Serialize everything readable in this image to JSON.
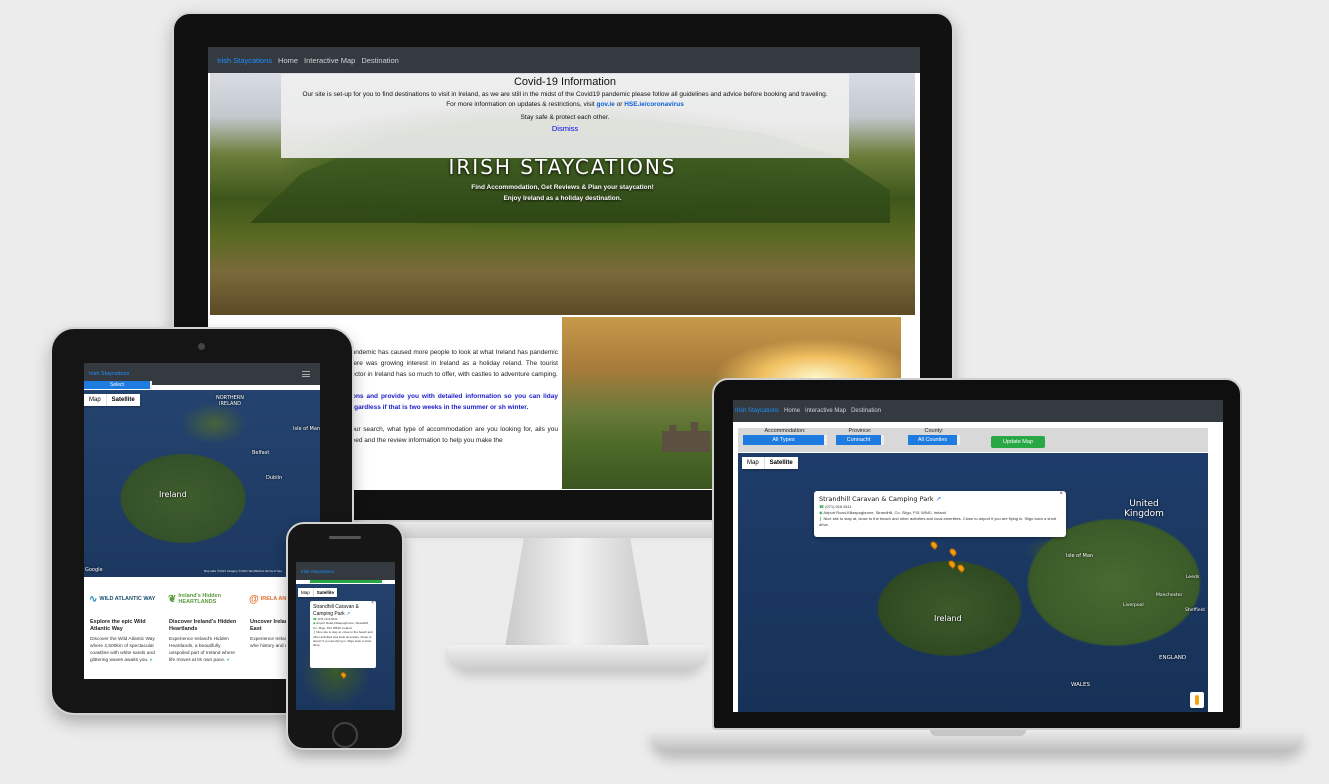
{
  "nav": {
    "brand": "Irish Staycations",
    "home": "Home",
    "map": "Interactive Map",
    "destination": "Destination"
  },
  "covid": {
    "title": "Covid-19 Information",
    "line1": "Our site is set-up for you to find destinations to visit in Ireland, as we are still in the midst of the Covid19 pandemic please follow all guidelines and advice before booking and traveling.",
    "line2_prefix": "For more information on updates & restrictions, visit",
    "link1": "gov.ie",
    "or": "or",
    "link2": "HSE.ie/coronavirus",
    "line3": "Stay safe & protect each other.",
    "dismiss": "Dismiss"
  },
  "hero": {
    "title": "IRISH STAYCATIONS",
    "sub1": "Find Accommodation, Get Reviews & Plan your staycation!",
    "sub2": "Enjoy Ireland as a holiday destination."
  },
  "intro": {
    "p1": "pandemic has caused more people to look at what Ireland has pandemic there was growing interest in Ireland as a holiday reland. The tourist sector in Ireland has so much to offer, with castles to adventure camping.",
    "p2": "tions and provide you with detailed information so you can liday regardless if that is two weeks in the summer or sh winter.",
    "p3": "your search, what type of accommodation are you looking for, ails you need and the review information to help you make the"
  },
  "filters": {
    "accommodation_label": "Accommodation:",
    "accommodation_value": "All Types",
    "province_label": "Province:",
    "province_value": "Connacht",
    "county_label": "County:",
    "county_value": "All Counties",
    "update_button": "Update Map"
  },
  "map": {
    "map_btn": "Map",
    "satellite_btn": "Satellite",
    "labels": {
      "uk": "United Kingdom",
      "ireland": "Ireland",
      "isle_of_man": "Isle of Man",
      "england": "ENGLAND",
      "wales": "WALES",
      "northern_ireland": "NORTHERN IRELAND",
      "dublin": "Dublin",
      "leeds": "Leeds",
      "manchester": "Manchester",
      "liverpool": "Liverpool",
      "sheffield": "Sheffield",
      "belfast": "Belfast",
      "google": "Google",
      "attribution": "Map data ©2021 Imagery ©2021 TerraMetrics  Terms of Use"
    }
  },
  "popup": {
    "title": "Strandhill Caravan & Camping Park",
    "phone": "(071) 916 8111",
    "address": "Airport Road,Killaspugbrone, Strandhill, Co. Sligo, F91 W540, Ireland",
    "desc": "Nice site to stay at, close to the beach and other activities and local amenities. Close to airport if you are flying in. Sligo town a short drive."
  },
  "tablet": {
    "select": "Select",
    "cards": [
      {
        "logo": "WILD ATLANTIC WAY",
        "title": "Explore the epic Wild Atlantic Way",
        "desc": "Discover the Wild Atlantic Way where 2,500km of spectacular coastline with white sands and glittering waves awaits you."
      },
      {
        "logo": "Ireland's Hidden HEARTLANDS",
        "title": "Discover Ireland's Hidden Heartlands",
        "desc": "Experience Ireland's Hidden Heartlands, a beautifully unspoiled part of Ireland where life moves at its own pace."
      },
      {
        "logo": "IRELA ANCIE",
        "title": "Uncover Ireland's Ancient East",
        "desc": "Experience Irelan Ancient East whe history and mode meet."
      }
    ]
  },
  "colors": {
    "nav_bg": "#343a40",
    "brand": "#1e90ff",
    "select_blue": "#1e7be0",
    "update_green": "#28a745"
  }
}
